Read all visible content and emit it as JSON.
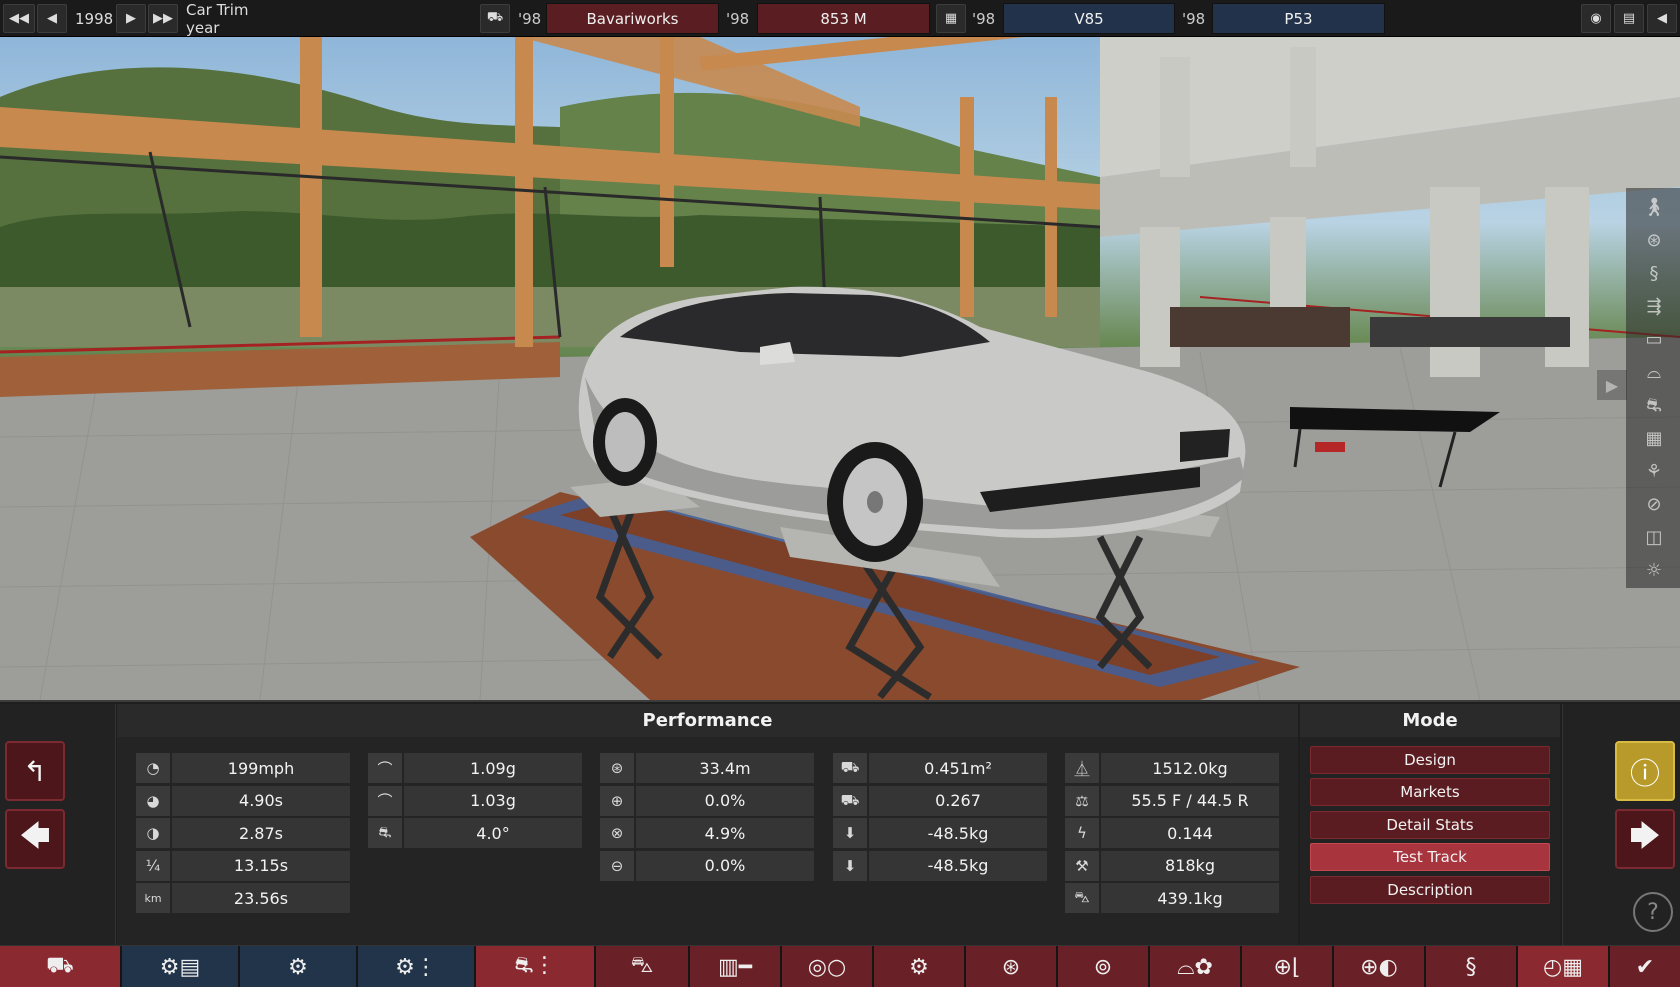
{
  "topbar": {
    "year": "1998",
    "year_label": "Car Trim year",
    "model_year_tag": "'98",
    "model_name": "Bavariworks",
    "trim_year_tag": "'98",
    "trim_name": "853 M",
    "engine_year_tag": "'98",
    "engine_family": "V85",
    "variant_year_tag": "'98",
    "engine_variant": "P53"
  },
  "panel": {
    "performance_title": "Performance",
    "mode_title": "Mode",
    "stats": {
      "col1": [
        "199mph",
        "4.90s",
        "2.87s",
        "13.15s",
        "23.56s"
      ],
      "col1_icons": [
        "speedometer-icon",
        "acceleration-icon",
        "acceleration-icon",
        "quarter-mile-icon",
        "km-icon"
      ],
      "col1_glyphs": [
        "◔",
        "◕",
        "◑",
        "¼",
        "km"
      ],
      "col2": [
        "1.09g",
        "1.03g",
        "4.0°"
      ],
      "col2_glyphs": [
        "⌒",
        "⌒",
        "⛐"
      ],
      "col3": [
        "33.4m",
        "0.0%",
        "4.9%",
        "0.0%"
      ],
      "col3_glyphs": [
        "⊛",
        "⊕",
        "⊗",
        "⊖"
      ],
      "col4": [
        "0.451m²",
        "0.267",
        "-48.5kg",
        "-48.5kg"
      ],
      "col4_glyphs": [
        "⛟",
        "⛟",
        "⬇",
        "⬇"
      ],
      "col5": [
        "1512.0kg",
        "55.5 F / 44.5 R",
        "0.144",
        "818kg",
        "439.1kg"
      ],
      "col5_glyphs": [
        "⏅",
        "⚖",
        "ϟ",
        "⚒",
        "⛍"
      ]
    },
    "modes": [
      "Design",
      "Markets",
      "Detail Stats",
      "Test Track",
      "Description"
    ],
    "active_mode": "Test Track"
  },
  "colors": {
    "accent_red": "#a8343d",
    "dark_red": "#5a1c21",
    "blue": "#22324a",
    "warning": "#b79a2a"
  }
}
